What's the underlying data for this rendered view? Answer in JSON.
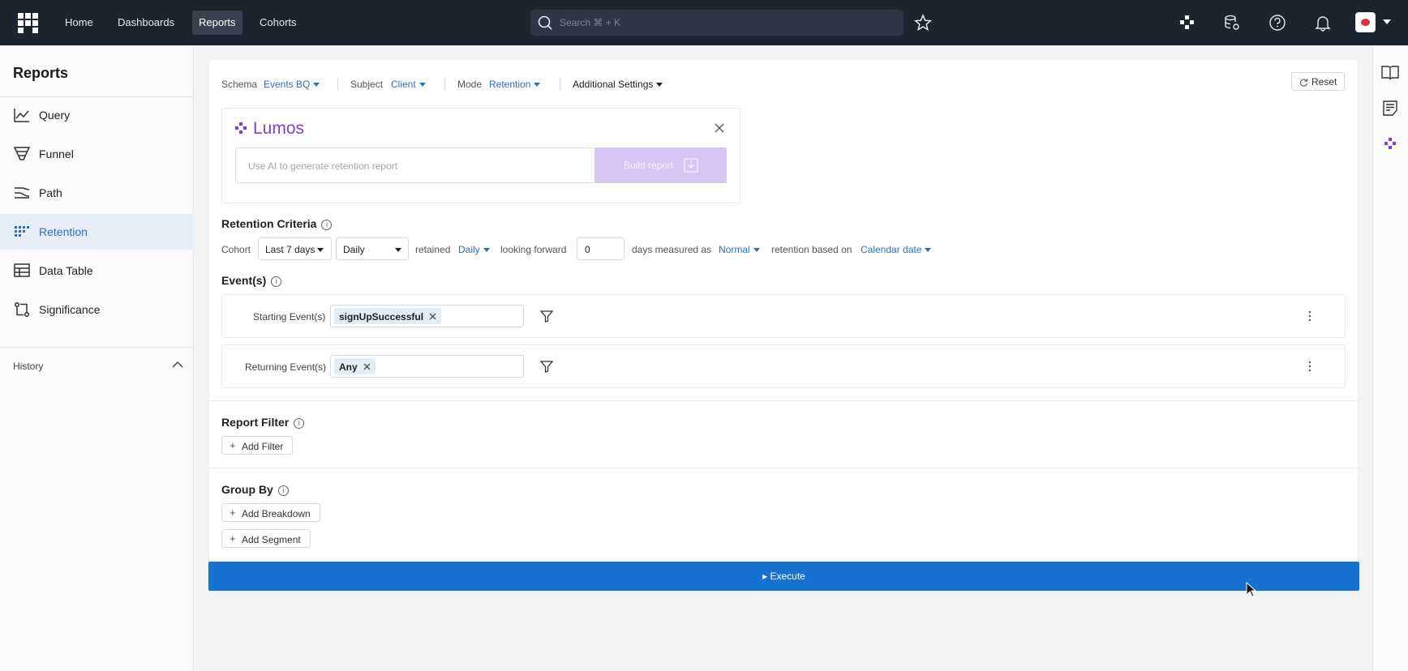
{
  "topnav": {
    "items": [
      {
        "label": "Home",
        "active": false
      },
      {
        "label": "Dashboards",
        "active": false
      },
      {
        "label": "Reports",
        "active": true
      },
      {
        "label": "Cohorts",
        "active": false
      }
    ],
    "search_placeholder": "Search ⌘ + K",
    "right_icons": [
      "lumos-icon",
      "database-settings-icon",
      "help-icon",
      "bell-icon",
      "avatar",
      "chevron-down-icon"
    ]
  },
  "sidebar": {
    "title": "Reports",
    "items": [
      {
        "label": "Query",
        "icon": "line-chart-icon",
        "selected": false
      },
      {
        "label": "Funnel",
        "icon": "funnel-icon",
        "selected": false
      },
      {
        "label": "Path",
        "icon": "path-icon",
        "selected": false
      },
      {
        "label": "Retention",
        "icon": "retention-grid-icon",
        "selected": true
      },
      {
        "label": "Data Table",
        "icon": "table-icon",
        "selected": false
      },
      {
        "label": "Significance",
        "icon": "significance-icon",
        "selected": false
      }
    ],
    "history_label": "History"
  },
  "settings": {
    "schema_label": "Schema",
    "schema_value": "Events BQ",
    "subject_label": "Subject",
    "subject_value": "Client",
    "mode_label": "Mode",
    "mode_value": "Retention",
    "additional_label": "Additional Settings",
    "reset_label": "Reset"
  },
  "lumos": {
    "title": "Lumos",
    "input_placeholder": "Use AI to generate retention report",
    "build_label": "Build report"
  },
  "retention": {
    "title": "Retention Criteria",
    "cohort_label": "Cohort",
    "cohort_range": "Last 7 days",
    "cohort_interval": "Daily",
    "retained_label": "retained",
    "retained_value": "Daily",
    "looking_label": "looking forward",
    "forward_value": "0",
    "days_label": "days measured as",
    "measure_value": "Normal",
    "based_label": "retention based on",
    "based_value": "Calendar date"
  },
  "events": {
    "title": "Event(s)",
    "starting_label": "Starting Event(s)",
    "starting_chip": "signUpSuccessful",
    "returning_label": "Returning Event(s)",
    "returning_chip": "Any"
  },
  "report_filter": {
    "title": "Report Filter",
    "add_label": "Add Filter"
  },
  "group_by": {
    "title": "Group By",
    "breakdown_label": "Add Breakdown",
    "segment_label": "Add Segment"
  },
  "execute_label": "▸ Execute",
  "colors": {
    "topbar": "#1c2430",
    "accent": "#1672d0",
    "lumos": "#7b3fd6",
    "selected_bg": "#e7eef8"
  }
}
